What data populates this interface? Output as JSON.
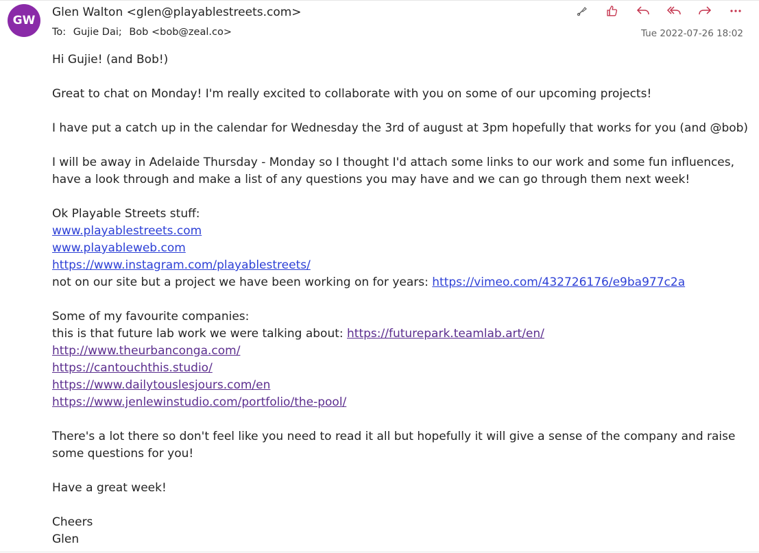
{
  "sender": {
    "initials": "GW",
    "display": "Glen Walton <glen@playablestreets.com>",
    "avatar_color": "#8a2aa8"
  },
  "recipients": {
    "label": "To:",
    "list": [
      "Gujie Dai;",
      "Bob <bob@zeal.co>"
    ]
  },
  "date": "Tue 2022-07-26 18:02",
  "toolbar": {
    "icons": [
      "paint-brush-icon",
      "thumbs-up-icon",
      "reply-icon",
      "reply-all-icon",
      "forward-icon",
      "more-icon"
    ],
    "accent": "#c4314b"
  },
  "body": {
    "greeting": "Hi Gujie! (and Bob!)",
    "p1": "Great to chat on Monday! I'm really excited to collaborate with you on some of our upcoming projects!",
    "p2": "I have put a catch up in the calendar for Wednesday the 3rd of august at 3pm hopefully that works for you (and @bob)",
    "p3_line1": "I will be away in Adelaide Thursday - Monday so I thought I'd attach some links to our work and some fun influences,",
    "p3_line2": "have a look through and make a list of any questions you may have and we can go through them next week!",
    "ps_heading": "Ok Playable Streets stuff:",
    "ps_links": [
      "www.playablestreets.com",
      "www.playableweb.com",
      "https://www.instagram.com/playablestreets/"
    ],
    "vimeo_text": "not on our site but a project we have been working on for years: ",
    "vimeo_link": "https://vimeo.com/432726176/e9ba977c2a",
    "fav_heading": "Some of my favourite companies:",
    "futurelab_text": "this is that future lab work we were talking about: ",
    "futurelab_link": "https://futurepark.teamlab.art/en/",
    "fav_links": [
      "http://www.theurbanconga.com/",
      "https://cantouchthis.studio/",
      "https://www.dailytouslesjours.com/en",
      "https://www.jenlewinstudio.com/portfolio/the-pool/"
    ],
    "closing_line1": "There's a lot there so don't feel like you need to read it all but hopefully it will give a sense of the company and raise",
    "closing_line2": "some questions for you!",
    "signoff": "Have a great week!",
    "cheers": "Cheers",
    "name": "Glen"
  },
  "colors": {
    "link": "#2c3fd6",
    "visited_link": "#5b2d8e"
  }
}
